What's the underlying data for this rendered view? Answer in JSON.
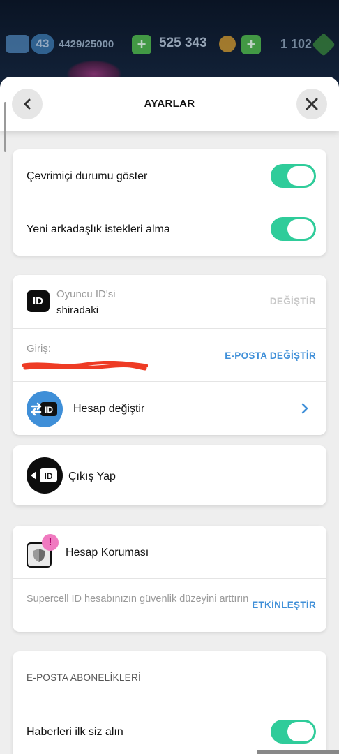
{
  "hud": {
    "level": "43",
    "xp": "4429/25000",
    "gold": "525 343",
    "gems": "1 102",
    "plus": "+"
  },
  "header": {
    "title": "AYARLAR",
    "back_icon": "chevron-left-icon",
    "close_icon": "close-icon"
  },
  "status_card": {
    "show_online": {
      "label": "Çevrimiçi durumu göster",
      "on": true
    },
    "no_friend_requests": {
      "label": "Yeni arkadaşlık istekleri alma",
      "on": true
    }
  },
  "account_card": {
    "player_id_label": "Oyuncu ID'si",
    "player_id_value": "shiradaki",
    "player_id_action": "DEĞİŞTİR",
    "login_label": "Giriş:",
    "login_action": "E-POSTA DEĞİŞTİR",
    "switch_label": "Hesap değiştir",
    "id_badge": "ID"
  },
  "logout": {
    "label": "Çıkış Yap",
    "badge": "ID"
  },
  "protection_card": {
    "title": "Hesap Koruması",
    "alert": "!",
    "description": "Supercell ID hesabınızın güvenlik düzeyini arttırın",
    "action": "ETKİNLEŞTİR"
  },
  "email_subs": {
    "heading": "E-POSTA ABONELİKLERİ",
    "news": {
      "label": "Haberleri ilk siz alın",
      "on": true
    }
  },
  "colors": {
    "toggle_on": "#2fcc9a",
    "link": "#3f8fd8",
    "switch_circle": "#3f8fd8",
    "alert_badge": "#f07ac0"
  }
}
